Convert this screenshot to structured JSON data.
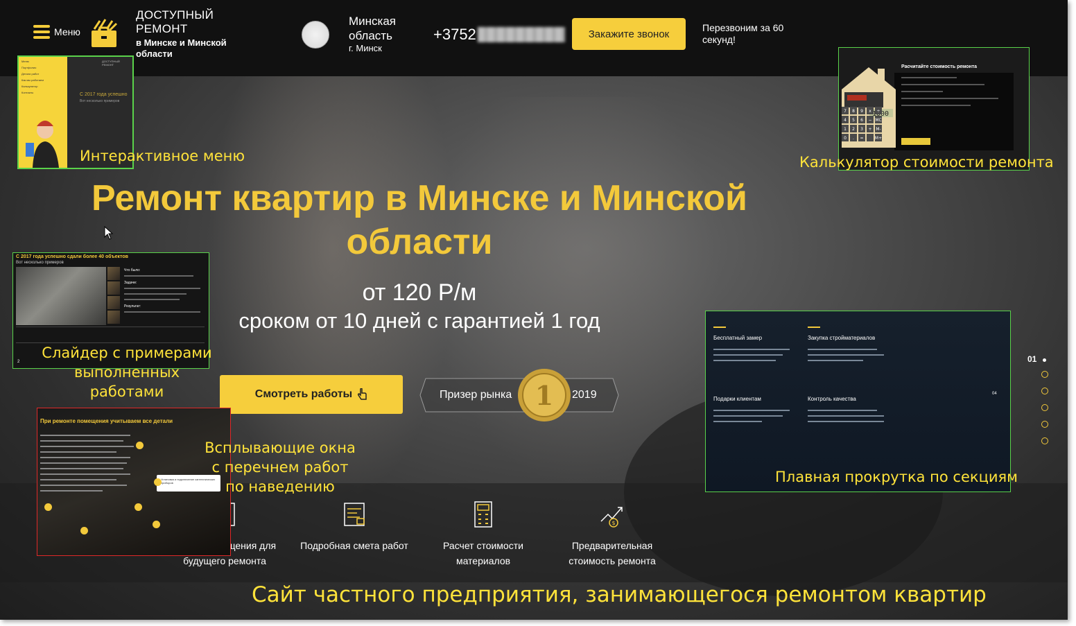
{
  "header": {
    "menu_label": "Меню",
    "brand_title": "ДОСТУПНЫЙ РЕМОНТ",
    "brand_subtitle": "в Минске и Минской области",
    "region": "Минская область",
    "city": "г. Минск",
    "phone": "+3752",
    "call_button": "Закажите звонок",
    "callback_note": "Перезвоним за 60 секунд!"
  },
  "hero": {
    "title": "Ремонт квартир в Минске и Минской области",
    "price": "от 120 Р/м",
    "term": "сроком от 10 дней с гарантией 1 год",
    "works_button": "Смотреть работы",
    "award_text": "Призер рынка",
    "award_place": "1",
    "award_year": "2019"
  },
  "features": [
    {
      "label": "Замер помещения для будущего ремонта",
      "icon": "ruler-icon"
    },
    {
      "label": "Подробная смета работ",
      "icon": "estimate-icon"
    },
    {
      "label": "Расчет стоимости материалов",
      "icon": "calculator-icon"
    },
    {
      "label": "Предварительная стоимость ремонта",
      "icon": "price-growth-icon"
    }
  ],
  "pager": {
    "current": "01"
  },
  "annotations": {
    "menu_label": "Интерактивное меню",
    "calc_label": "Калькулятор стоимости ремонта",
    "slider_label": "Слайдер с примерами выполненных работами",
    "popup_label": "Всплывающие окна с перечнем работ по наведению",
    "scroll_label": "Плавная прокрутка по секциям",
    "caption": "Сайт частного предприятия, занимающегося ремонтом квартир"
  },
  "menu_preview": {
    "items": [
      "Меню",
      "Портфолио",
      "Детали работ",
      "Как мы работаем",
      "Калькулятор",
      "Контакты"
    ],
    "brand": "ДОСТУПНЫЙ РЕМОНТ",
    "headline": "С 2017 года успешно",
    "sub": "Вот несколько примеров"
  },
  "calc_preview": {
    "title": "Расчитайте стоимость ремонта",
    "display": "1000",
    "keys": [
      "7",
      "8",
      "9",
      "x",
      "÷",
      "4",
      "5",
      "6",
      "−",
      "MC",
      "1",
      "2",
      "3",
      "+",
      "M-",
      "0",
      ".",
      "=",
      "",
      "M+"
    ],
    "button": "Расчитать"
  },
  "slider_preview": {
    "title": "С 2017 года успешно сдали более 40 объектов",
    "sub": "Вот несколько примеров",
    "what_was": "Что было:",
    "tasks": "Задачи:",
    "result": "Результат:",
    "page": "2"
  },
  "popup_preview": {
    "title": "При ремонте помещения учитываем все детали",
    "body": "Качество ремонта всегда соответствует ожиданиям клиентов. Для для выполнения работ используем только качественные материалы. Многие производители - наши постоянные партнеры. Комплексный ремонт силами одного подрядчика позволяет организовать взаимосвязанные по времени работы по ремонту, его контроль и обеспечение. Все это минимизирует сроки выполнения заказа.",
    "tip": "Установка и подключение сантехнических приборов"
  },
  "scroll_preview": {
    "items": [
      {
        "title": "Бесплатный замер",
        "text": "Замерщик приедет на замер в удобное для Вас время и бесплатно составит смету"
      },
      {
        "title": "Закупка стройматериалов",
        "text": "Поможем с закупкой или самостоятельно закупим стройматериалы"
      },
      {
        "title": "Подарки клиентам",
        "text": "При заказе ремонта под ключ дарим приятные подарки нашим Клиентам"
      },
      {
        "title": "Контроль качества",
        "text": "В любой момент Вы сможете самостоятельно оценить качество проводимых работ"
      }
    ],
    "page": "04"
  },
  "colors": {
    "accent": "#f3c93b",
    "label": "#ffe33a",
    "annot_green": "#5ad34a",
    "annot_red": "#e02828"
  }
}
